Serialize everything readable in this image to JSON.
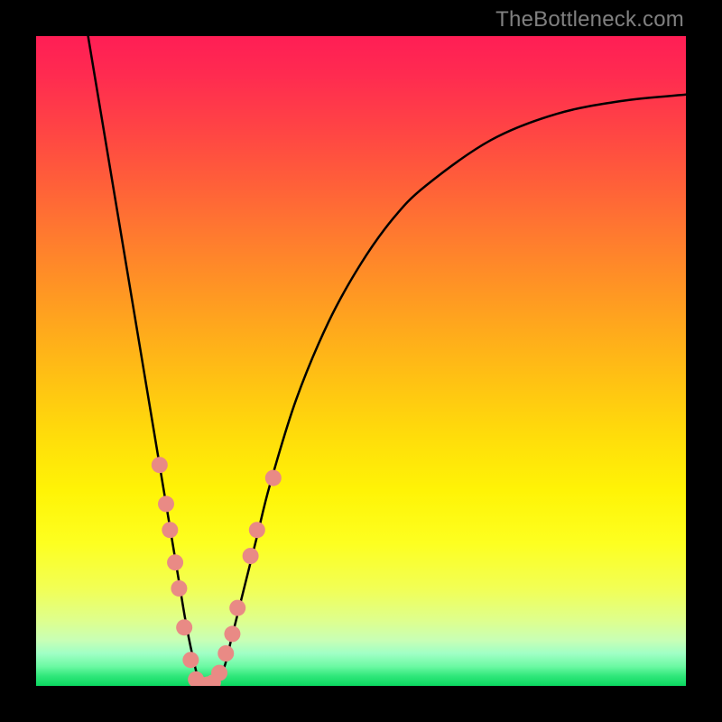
{
  "watermark": "TheBottleneck.com",
  "colors": {
    "curve": "#000000",
    "dot_fill": "#e98a85",
    "dot_stroke": "none"
  },
  "chart_data": {
    "type": "line",
    "title": "",
    "xlabel": "",
    "ylabel": "",
    "xlim": [
      0,
      100
    ],
    "ylim": [
      0,
      100
    ],
    "series": [
      {
        "name": "bottleneck-curve",
        "x": [
          8,
          10,
          12,
          14,
          16,
          18,
          20,
          21,
          22,
          23,
          24,
          25,
          26,
          27,
          28,
          29,
          30,
          32,
          34,
          36,
          40,
          45,
          50,
          55,
          60,
          70,
          80,
          90,
          100
        ],
        "y": [
          100,
          88,
          76,
          64,
          52,
          40,
          28,
          22,
          16,
          10,
          5,
          1,
          0,
          0,
          1,
          3,
          7,
          15,
          23,
          31,
          44,
          56,
          65,
          72,
          77,
          84,
          88,
          90,
          91
        ]
      }
    ],
    "dots": [
      {
        "x": 19.0,
        "y": 34.0
      },
      {
        "x": 20.0,
        "y": 28.0
      },
      {
        "x": 20.6,
        "y": 24.0
      },
      {
        "x": 21.4,
        "y": 19.0
      },
      {
        "x": 22.0,
        "y": 15.0
      },
      {
        "x": 22.8,
        "y": 9.0
      },
      {
        "x": 23.8,
        "y": 4.0
      },
      {
        "x": 24.6,
        "y": 1.0
      },
      {
        "x": 25.4,
        "y": 0.2
      },
      {
        "x": 26.4,
        "y": 0.2
      },
      {
        "x": 27.2,
        "y": 0.5
      },
      {
        "x": 28.2,
        "y": 2.0
      },
      {
        "x": 29.2,
        "y": 5.0
      },
      {
        "x": 30.2,
        "y": 8.0
      },
      {
        "x": 31.0,
        "y": 12.0
      },
      {
        "x": 33.0,
        "y": 20.0
      },
      {
        "x": 34.0,
        "y": 24.0
      },
      {
        "x": 36.5,
        "y": 32.0
      }
    ],
    "dot_radius_px": 9
  }
}
